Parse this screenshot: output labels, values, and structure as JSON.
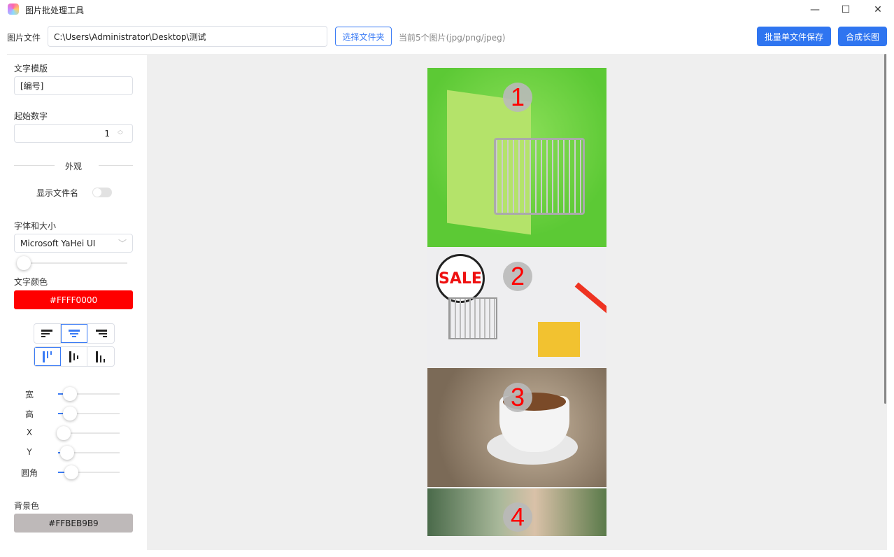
{
  "window": {
    "title": "图片批处理工具",
    "icon": "app-icon",
    "controls": [
      "minimize",
      "maximize",
      "close"
    ]
  },
  "toolbar": {
    "file_label": "图片文件",
    "path_value": "C:\\Users\\Administrator\\Desktop\\测试",
    "choose_folder": "选择文件夹",
    "info": "当前5个图片(jpg/png/jpeg)",
    "batch_save": "批量单文件保存",
    "merge_long": "合成长图"
  },
  "sidebar": {
    "template_label": "文字模版",
    "template_value": "[编号]",
    "start_label": "起始数字",
    "start_value": "1",
    "appearance_label": "外观",
    "show_filename_label": "显示文件名",
    "show_filename": false,
    "font_label": "字体和大小",
    "font_value": "Microsoft YaHei UI",
    "font_size_level": 0,
    "text_color_label": "文字颜色",
    "text_color": "#FFFF0000",
    "text_color_hex": "#ff0000",
    "h_align": [
      "left",
      "center",
      "right"
    ],
    "h_align_selected": "center",
    "v_align": [
      "top",
      "middle",
      "bottom"
    ],
    "v_align_selected": "top",
    "sliders": [
      {
        "label": "宽",
        "value": 0.1
      },
      {
        "label": "高",
        "value": 0.1
      },
      {
        "label": "X",
        "value": 0
      },
      {
        "label": "Y",
        "value": 0.06
      },
      {
        "label": "圆角",
        "value": 0.13
      }
    ],
    "bg_label": "背景色",
    "bg_color": "#FFBEB9B9",
    "bg_color_hex": "#beb9b9"
  },
  "preview": {
    "images": [
      {
        "number": "1",
        "desc": "shopping bag with cart"
      },
      {
        "number": "2",
        "desc": "SALE cart with gold"
      },
      {
        "number": "3",
        "desc": "coffee cup"
      },
      {
        "number": "4",
        "desc": "woman portrait"
      }
    ]
  }
}
